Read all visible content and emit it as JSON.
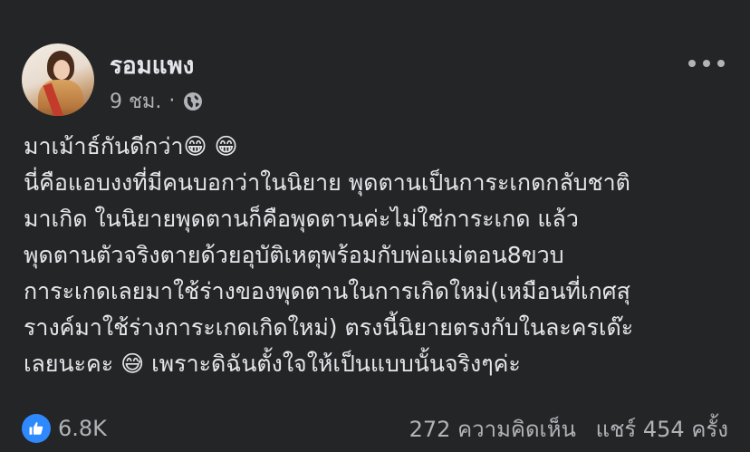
{
  "post": {
    "author": "รอมแพง",
    "time": "9 ชม.",
    "separator": "·",
    "privacy_icon": "globe-icon",
    "more_icon": "more-options-icon",
    "lines": [
      "มาเม้าธ์กันดีกว่า😁 😁",
      "นี่คือแอบงงที่มีคนบอกว่าในนิยาย พุดตานเป็นการะเกดกลับชาติ",
      "มาเกิด ในนิยายพุดตานก็คือพุดตานค่ะไม่ใช่การะเกด แล้ว",
      "พุดตานตัวจริงตายด้วยอุบัติเหตุพร้อมกับพ่อแม่ตอน8ขวบ",
      "การะเกดเลยมาใช้ร่างของพุดตานในการเกิดใหม่(เหมือนที่เกศสุ",
      "รางค์มาใช้ร่างการะเกดเกิดใหม่) ตรงนี้นิยายตรงกับในละครเด๊ะ",
      "เลยนะคะ 😅 เพราะดิฉันตั้งใจให้เป็นแบบนั้นจริงๆค่ะ"
    ]
  },
  "footer": {
    "reaction_icon": "like-icon",
    "reaction_count": "6.8K",
    "comments": "272 ความคิดเห็น",
    "shares": "แชร์ 454 ครั้ง"
  },
  "colors": {
    "background": "#242526",
    "text": "#e4e6eb",
    "secondary": "#b0b3b8",
    "like_blue": "#2e89ff"
  }
}
